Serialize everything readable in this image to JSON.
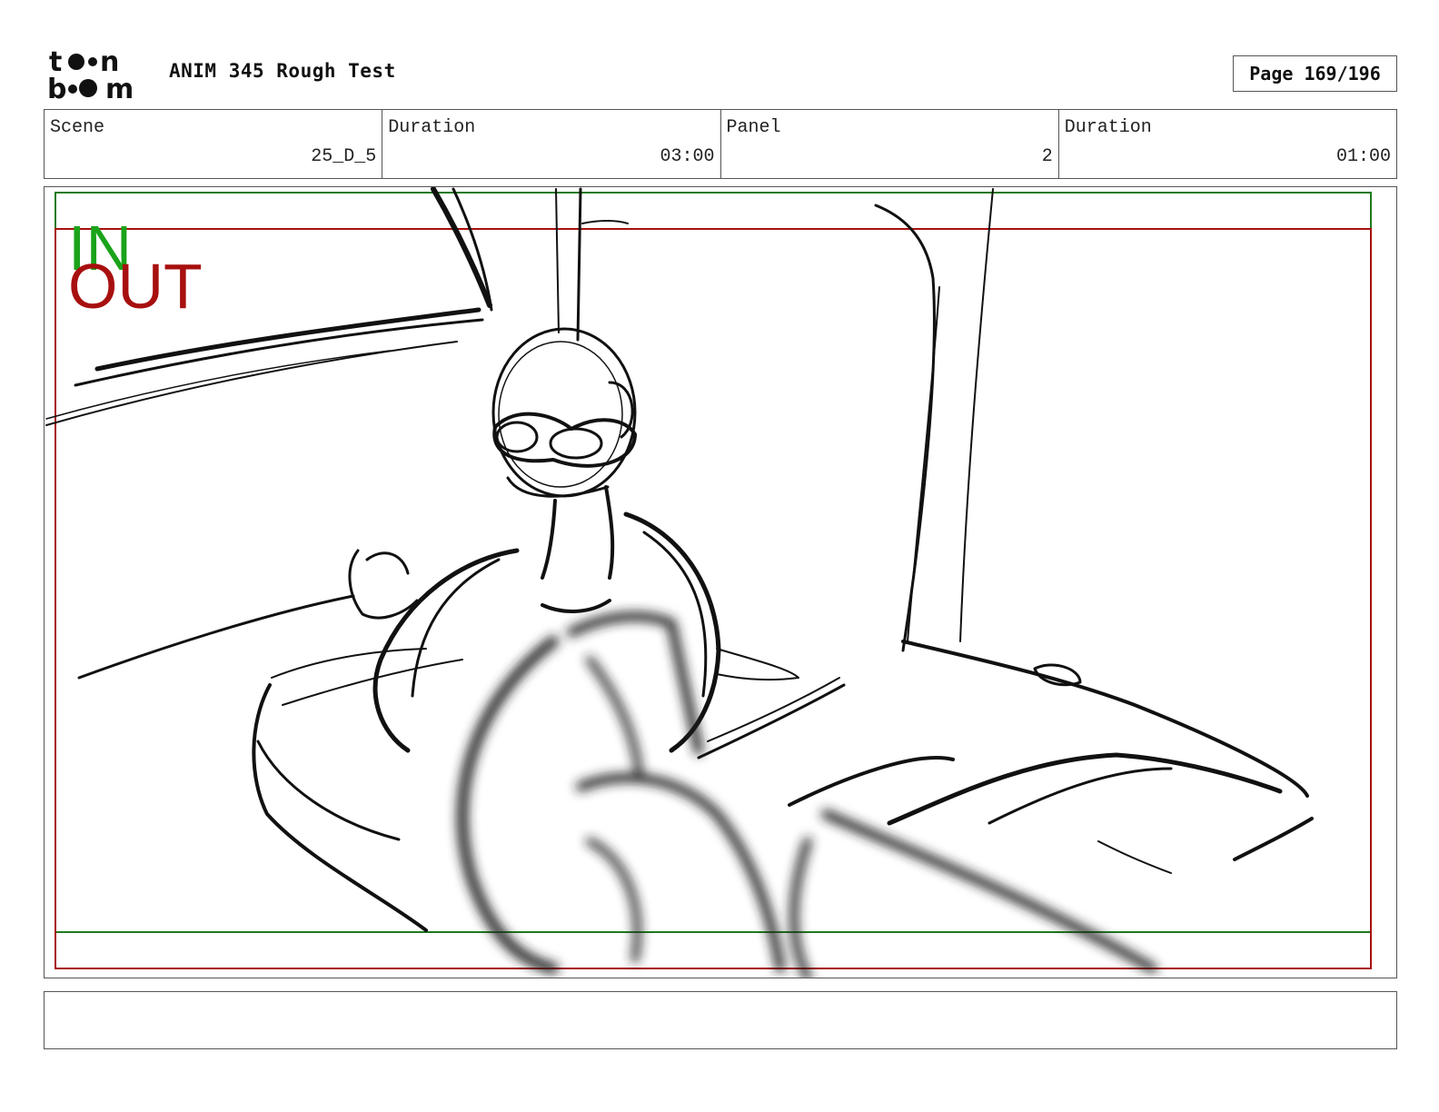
{
  "header": {
    "logo_text": "toon boom",
    "title": "ANIM 345 Rough Test",
    "page": "Page 169/196"
  },
  "info": {
    "scene": {
      "label": "Scene",
      "value": "25_D_5"
    },
    "scene_duration": {
      "label": "Duration",
      "value": "03:00"
    },
    "panel": {
      "label": "Panel",
      "value": "2"
    },
    "panel_duration": {
      "label": "Duration",
      "value": "01:00"
    }
  },
  "frame_labels": {
    "in": "IN",
    "out": "OUT"
  },
  "colors": {
    "in_frame": "#1aa31a",
    "out_frame": "#a80f0f",
    "sketch": "#111111"
  },
  "notes": ""
}
